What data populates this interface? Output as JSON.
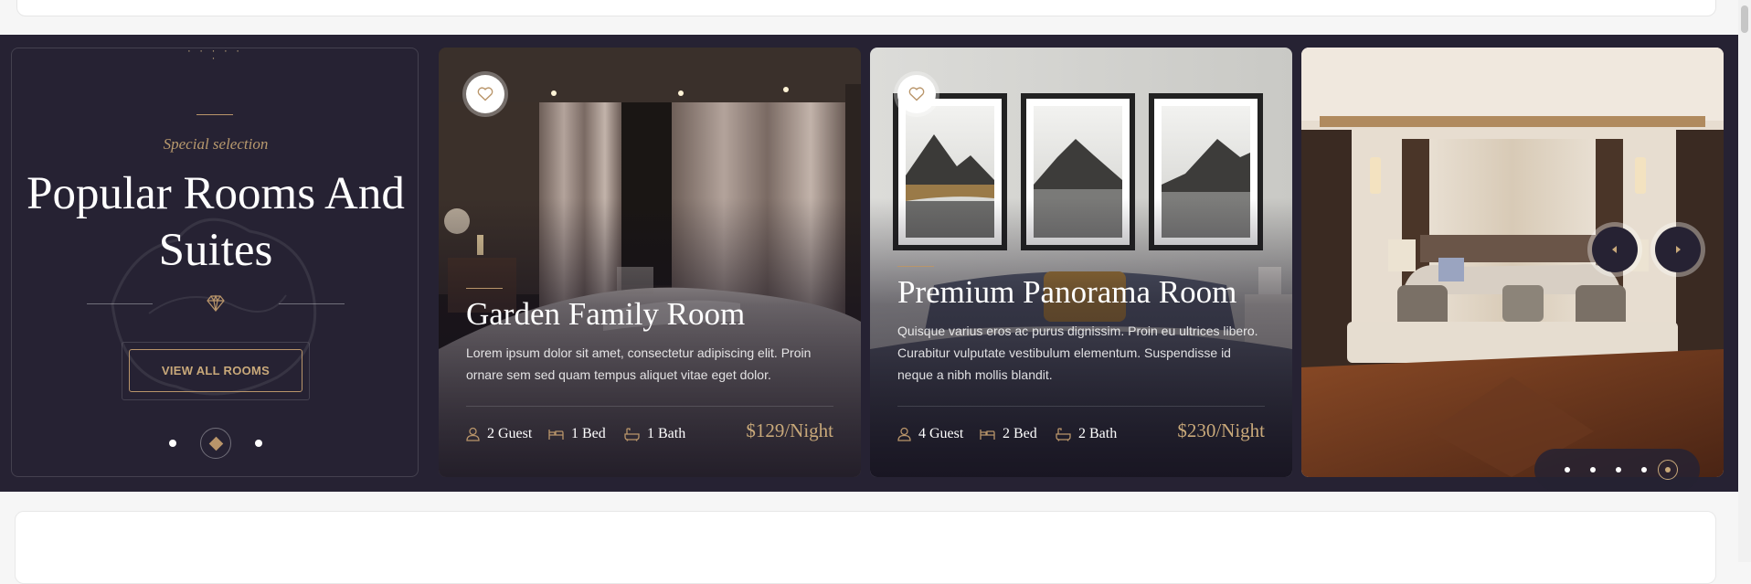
{
  "intro": {
    "kicker": "Special selection",
    "title": "Popular Rooms And Suites",
    "button_label": "VIEW ALL ROOMS",
    "pager_count": 3,
    "pager_active": 2
  },
  "rooms": [
    {
      "title": "Garden Family Room",
      "description": "Lorem ipsum dolor sit amet, consectetur adipiscing elit. Proin ornare sem sed quam tempus aliquet vitae eget dolor.",
      "guests": "2 Guest",
      "beds": "1 Bed",
      "baths": "1 Bath",
      "price": "$129/Night"
    },
    {
      "title": "Premium Panorama Room",
      "description": "Quisque varius eros ac purus dignissim. Proin eu ultrices libero. Curabitur vulputate vestibulum elementum. Suspendisse id neque a nibh mollis blandit.",
      "guests": "4 Guest",
      "beds": "2 Bed",
      "baths": "2 Bath",
      "price": "$230/Night"
    }
  ],
  "slider": {
    "dot_count": 5,
    "active_dot": 5
  },
  "colors": {
    "section_bg": "#262233",
    "accent_gold": "#b9956a",
    "price_gold": "#c9a97a"
  },
  "icons": [
    "heart-icon",
    "guest-icon",
    "bed-icon",
    "bath-icon",
    "diamond-icon",
    "prev-arrow-icon",
    "next-arrow-icon"
  ]
}
